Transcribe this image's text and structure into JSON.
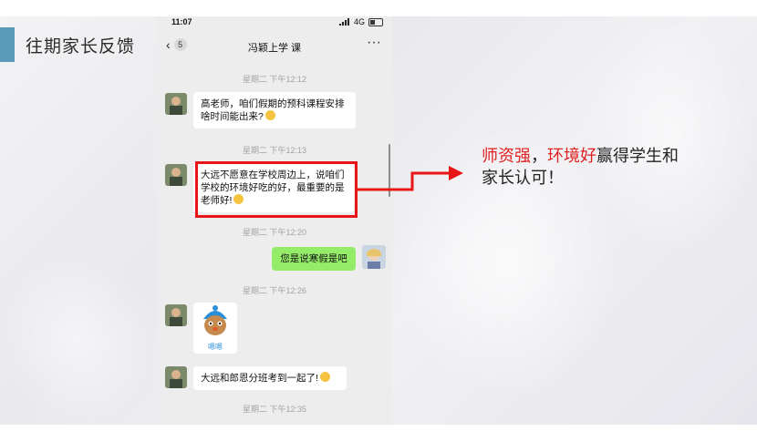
{
  "slide": {
    "section_title": "往期家长反馈",
    "annotation": {
      "part1": "师资强",
      "sep1": "，",
      "part2": "环境好",
      "part3": "赢得学生和",
      "line2": "家长认可！"
    }
  },
  "phone": {
    "status": {
      "time": "11:07",
      "signal": "4G"
    },
    "nav": {
      "back_count": "5",
      "title": "冯颖上学 课",
      "more": "···"
    },
    "messages": [
      {
        "timestamp": "星期二 下午12:12",
        "from": "parent",
        "text": "高老师，咱们假期的预科课程安排啥时间能出来?"
      },
      {
        "timestamp": "星期二 下午12:13",
        "from": "parent",
        "text": "大远不愿意在学校周边上，说咱们学校的环境好吃的好，最重要的是老师好!"
      },
      {
        "timestamp": "星期二 下午12:20",
        "from": "teacher",
        "text": "您是说寒假是吧"
      },
      {
        "timestamp": "星期二 下午12:26",
        "from": "parent",
        "sticker_label": "嗯嗯"
      },
      {
        "timestamp": "",
        "from": "parent",
        "text": "大远和郎恩分班考到一起了!"
      },
      {
        "timestamp": "星期二 下午12:35"
      }
    ]
  },
  "colors": {
    "accent_red": "#e81616",
    "bubble_green": "#95ec69",
    "side_bar_blue": "#5a9bbb"
  }
}
